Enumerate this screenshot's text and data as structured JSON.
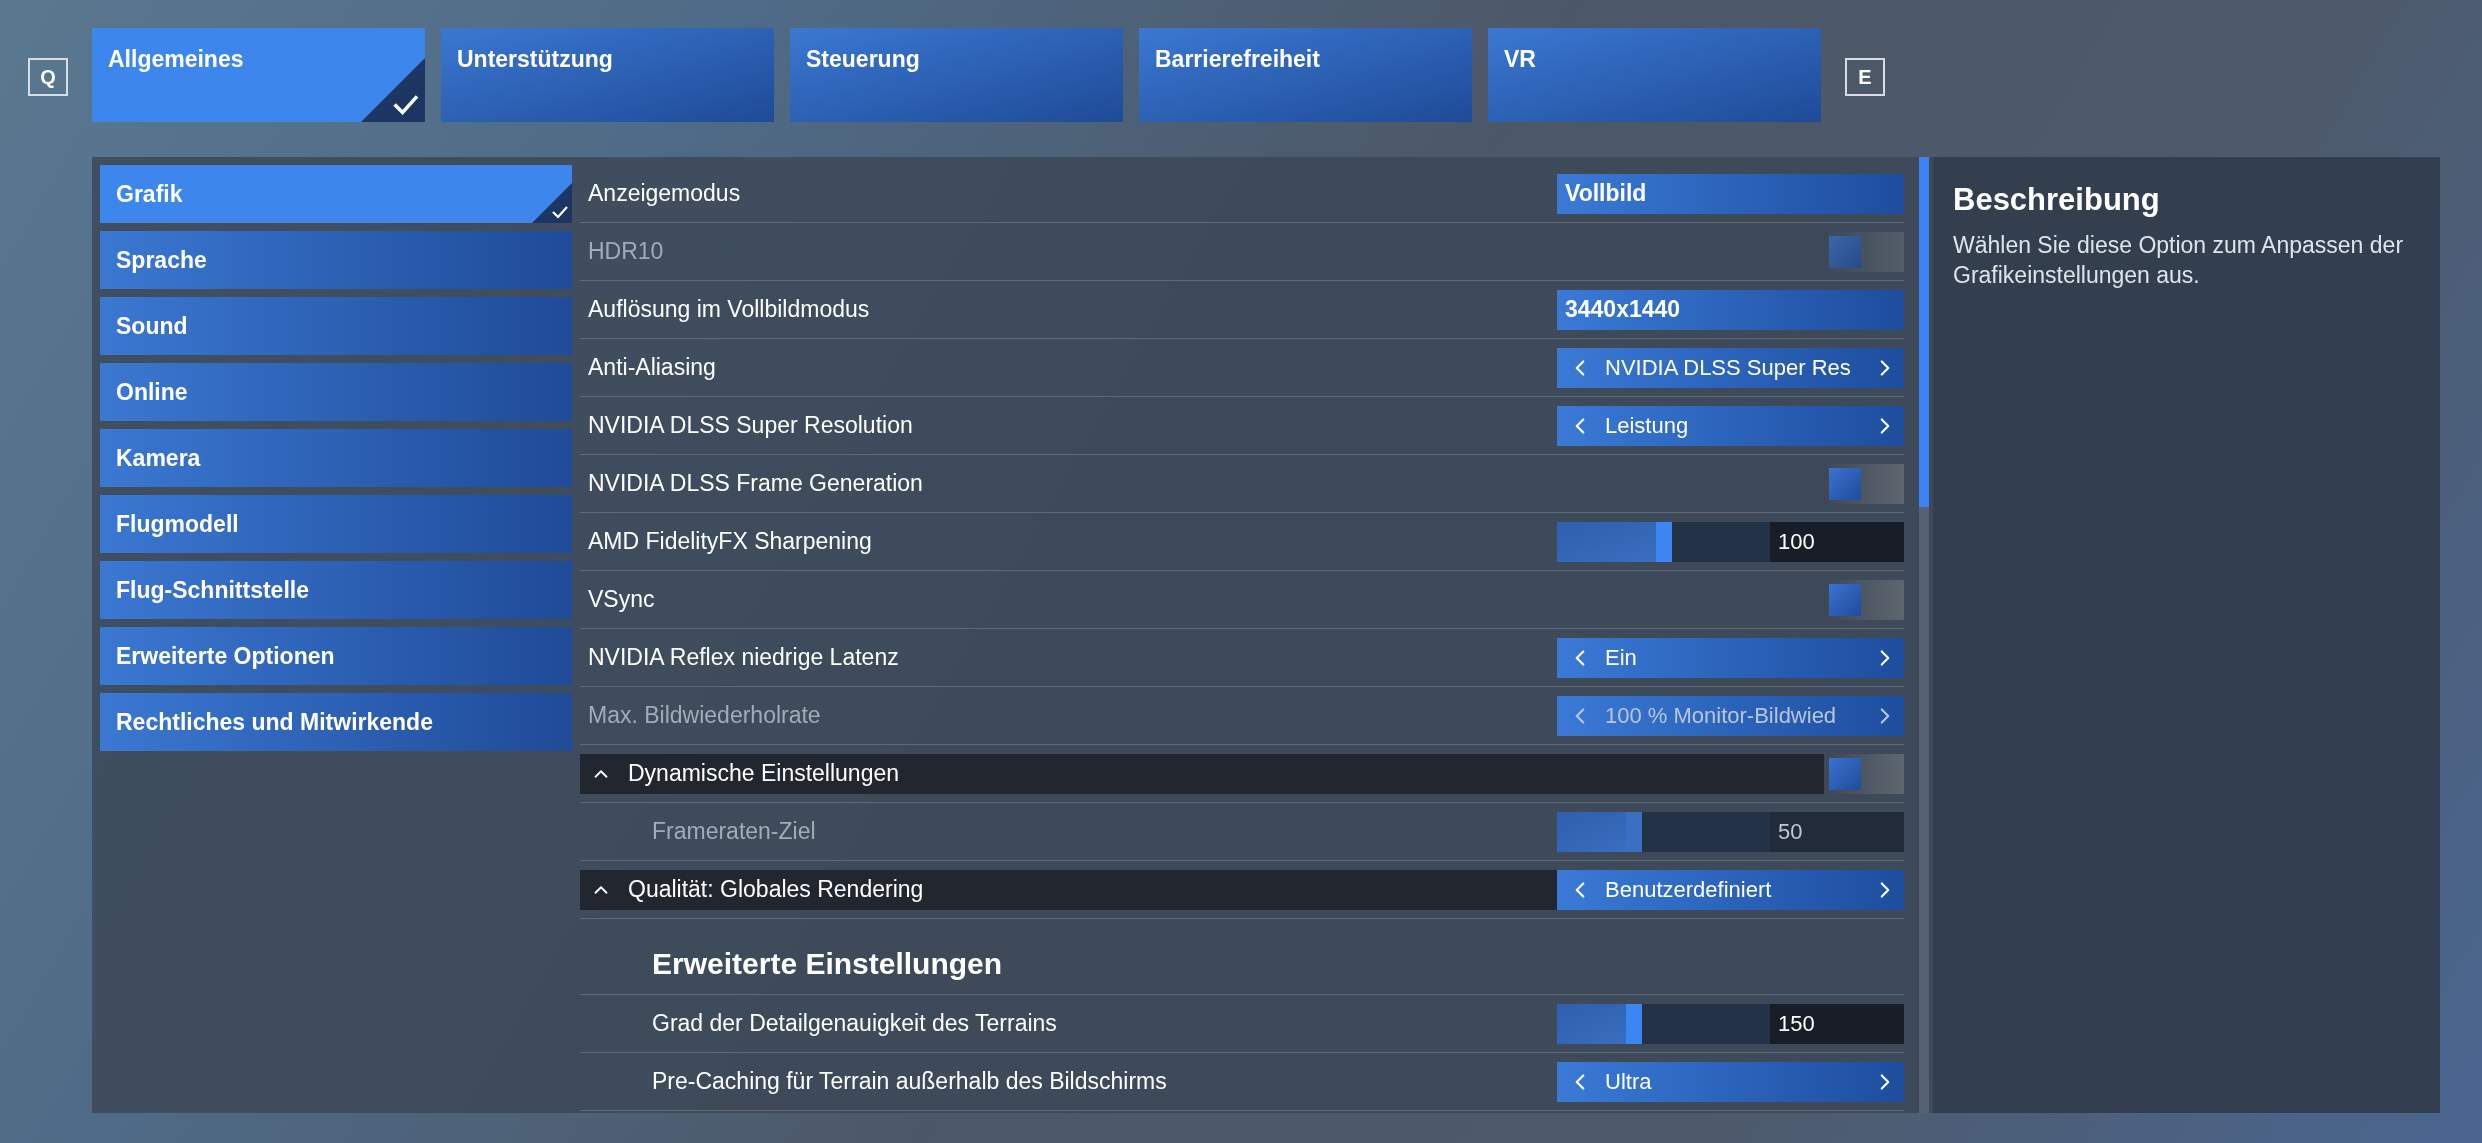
{
  "nav_keys": {
    "left": "Q",
    "right": "E"
  },
  "tabs": [
    {
      "label": "Allgemeines",
      "selected": true
    },
    {
      "label": "Unterstützung",
      "selected": false
    },
    {
      "label": "Steuerung",
      "selected": false
    },
    {
      "label": "Barrierefreiheit",
      "selected": false
    },
    {
      "label": "VR",
      "selected": false
    }
  ],
  "sidebar": {
    "items": [
      {
        "label": "Grafik",
        "selected": true
      },
      {
        "label": "Sprache",
        "selected": false
      },
      {
        "label": "Sound",
        "selected": false
      },
      {
        "label": "Online",
        "selected": false
      },
      {
        "label": "Kamera",
        "selected": false
      },
      {
        "label": "Flugmodell",
        "selected": false
      },
      {
        "label": "Flug-Schnittstelle",
        "selected": false
      },
      {
        "label": "Erweiterte Optionen",
        "selected": false
      },
      {
        "label": "Rechtliches und Mitwirkende",
        "selected": false
      }
    ]
  },
  "settings": [
    {
      "kind": "dropdown",
      "label": "Anzeigemodus",
      "value": "Vollbild",
      "disabled": false
    },
    {
      "kind": "toggle",
      "label": "HDR10",
      "on": false,
      "disabled": true
    },
    {
      "kind": "dropdown",
      "label": "Auflösung im Vollbildmodus",
      "value": "3440x1440",
      "disabled": false
    },
    {
      "kind": "selector",
      "label": "Anti-Aliasing",
      "value": "NVIDIA DLSS Super Res",
      "disabled": false
    },
    {
      "kind": "selector",
      "label": "NVIDIA DLSS Super Resolution",
      "value": "Leistung",
      "disabled": false
    },
    {
      "kind": "toggle",
      "label": "NVIDIA DLSS Frame Generation",
      "on": false,
      "disabled": false
    },
    {
      "kind": "slider",
      "label": "AMD FidelityFX Sharpening",
      "level": 0.5,
      "value": "100",
      "disabled": false
    },
    {
      "kind": "toggle",
      "label": "VSync",
      "on": false,
      "disabled": false
    },
    {
      "kind": "selector",
      "label": "NVIDIA Reflex niedrige Latenz",
      "value": "Ein",
      "disabled": false
    },
    {
      "kind": "selector",
      "label": "Max. Bildwiederholrate",
      "value": "100 % Monitor-Bildwied",
      "disabled": true
    },
    {
      "kind": "header",
      "label": "Dynamische Einstellungen",
      "expanded": true,
      "control": {
        "kind": "toggle",
        "on": false
      },
      "children": [
        {
          "kind": "slider",
          "label": "Frameraten-Ziel",
          "level": 0.36,
          "value": "50",
          "disabled": true
        }
      ]
    },
    {
      "kind": "header",
      "label": "Qualität: Globales Rendering",
      "expanded": true,
      "control": {
        "kind": "selector",
        "value": "Benutzerdefiniert"
      },
      "children": [
        {
          "kind": "subheading",
          "label": "Erweiterte Einstellungen"
        },
        {
          "kind": "slider",
          "label": "Grad der Detailgenauigkeit des Terrains",
          "level": 0.36,
          "value": "150",
          "disabled": false
        },
        {
          "kind": "selector",
          "label": "Pre-Caching für Terrain außerhalb des Bildschirms",
          "value": "Ultra",
          "disabled": false
        }
      ]
    }
  ],
  "description": {
    "title": "Beschreibung",
    "text": "Wählen Sie diese Option zum Anpassen der Grafikeinstellungen aus."
  }
}
